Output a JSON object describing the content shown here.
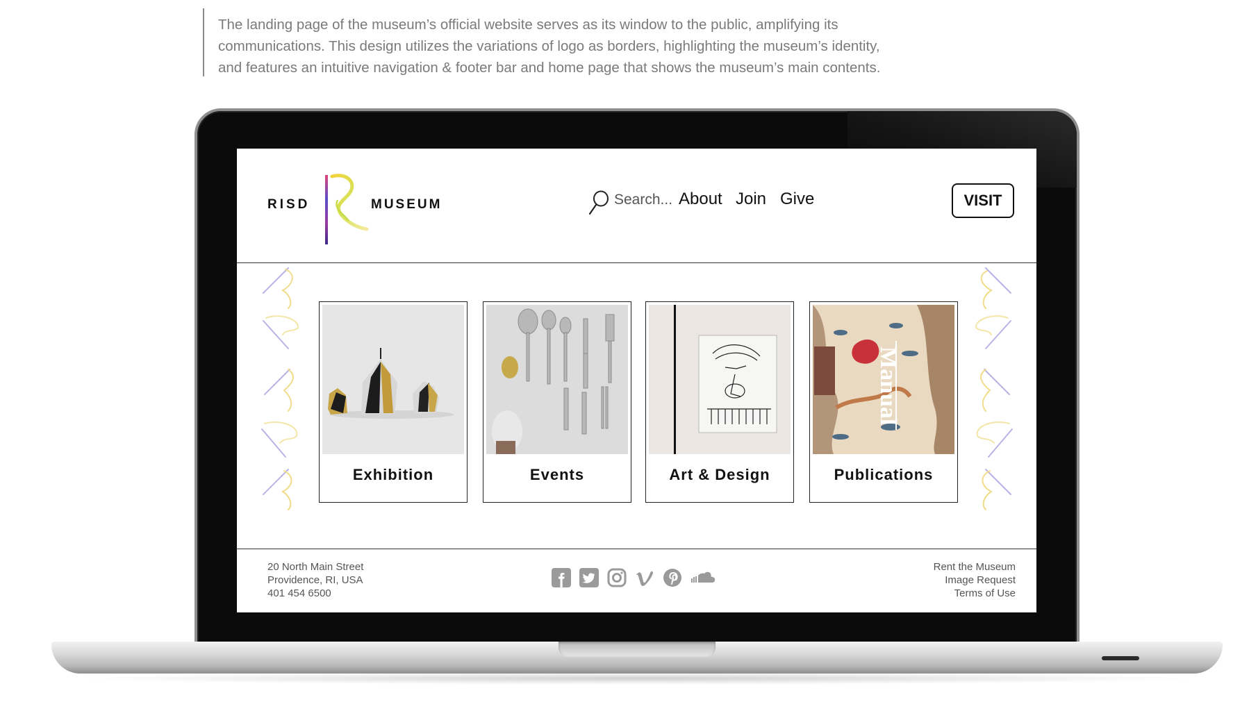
{
  "description_lines": [
    "The landing page of the museum’s official website serves as its window to the public, amplifying its",
    "communications. This design utilizes the variations of logo as borders, highlighting the museum’s identity,",
    "and features an intuitive navigation & footer bar and home page that shows the museum’s main contents."
  ],
  "header": {
    "logo_left": "RISD",
    "logo_right": "MUSEUM",
    "search_placeholder": "Search...",
    "nav": [
      "About",
      "Join",
      "Give"
    ],
    "visit_label": "VISIT"
  },
  "cards": [
    {
      "label": "Exhibition"
    },
    {
      "label": "Events"
    },
    {
      "label": "Art & Design"
    },
    {
      "label": "Publications"
    }
  ],
  "publication_cover_text": "Manual",
  "footer": {
    "address_lines": [
      "20 North Main Street",
      "Providence, RI, USA",
      "401 454 6500"
    ],
    "social": [
      "facebook-icon",
      "twitter-icon",
      "instagram-icon",
      "vimeo-icon",
      "pinterest-icon",
      "soundcloud-icon"
    ],
    "links": [
      "Rent the Museum",
      "Image Request",
      "Terms of Use"
    ]
  },
  "colors": {
    "icon_gray": "#9a9a9a",
    "text_dark": "#111111",
    "text_gray": "#7a7a7a"
  }
}
